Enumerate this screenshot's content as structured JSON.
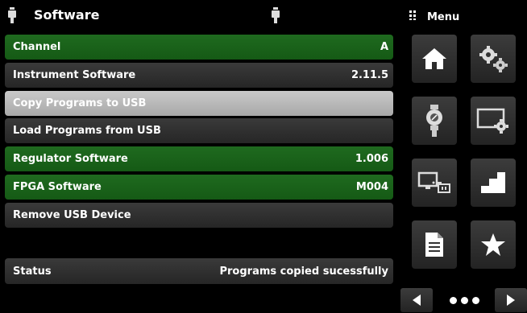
{
  "header": {
    "title": "Software"
  },
  "menu": {
    "label": "Menu"
  },
  "rows": [
    {
      "label": "Channel",
      "value": "A"
    },
    {
      "label": "Instrument Software",
      "value": "2.11.5"
    },
    {
      "label": "Copy Programs to USB",
      "value": ""
    },
    {
      "label": "Load Programs from USB",
      "value": ""
    },
    {
      "label": "Regulator Software",
      "value": "1.006"
    },
    {
      "label": "FPGA Software",
      "value": "M004"
    },
    {
      "label": "Remove USB Device",
      "value": ""
    }
  ],
  "status": {
    "label": "Status",
    "value": "Programs copied sucessfully"
  },
  "colors": {
    "green_row": "#1a631a",
    "dark_row": "#2f2f2f",
    "selected_row": "#b8b8b8"
  },
  "icons": [
    "sensor-icon",
    "grip-icon",
    "home-icon",
    "gears-icon",
    "regulator-icon",
    "monitor-gear-icon",
    "remote-display-icon",
    "step-chart-icon",
    "document-icon",
    "star-icon",
    "arrow-left-icon",
    "arrow-right-icon"
  ]
}
